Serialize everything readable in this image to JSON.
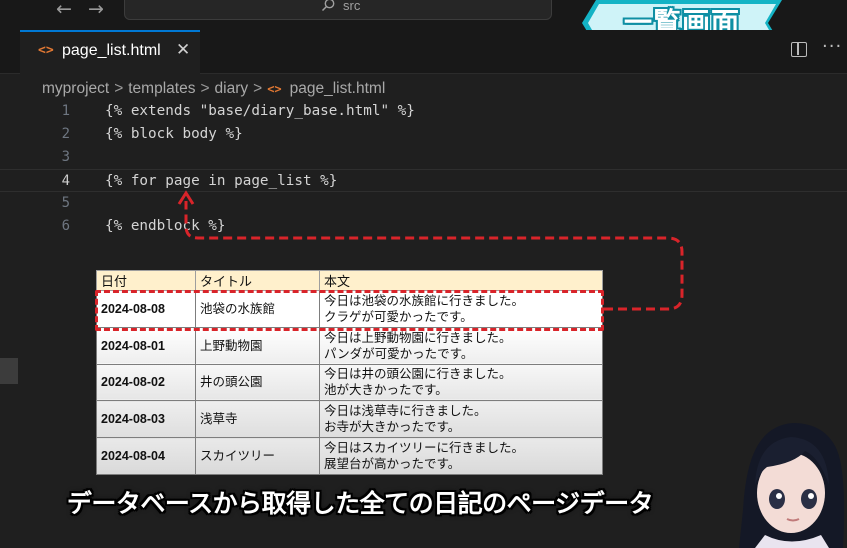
{
  "titlebar": {
    "back_glyph": "←",
    "forward_glyph": "→",
    "search_text": "src"
  },
  "banner": {
    "text": "一覧画面",
    "color": "#14b3c5"
  },
  "tab": {
    "icon_glyph": "<>",
    "label": "page_list.html",
    "close_glyph": "✕",
    "more_glyph": "···"
  },
  "breadcrumb": {
    "parts": [
      "myproject",
      "templates",
      "diary"
    ],
    "file_icon": "<>",
    "file": "page_list.html",
    "separator": ">"
  },
  "editor": {
    "lines": [
      {
        "number": "1",
        "code": "{% extends \"base/diary_base.html\" %}"
      },
      {
        "number": "2",
        "code": "{% block body %}"
      },
      {
        "number": "3",
        "code": ""
      },
      {
        "number": "4",
        "code": "{% for page in page_list %}"
      },
      {
        "number": "5",
        "code": ""
      },
      {
        "number": "6",
        "code": "{% endblock %}"
      }
    ],
    "current_line": "4"
  },
  "table": {
    "headers": [
      "日付",
      "タイトル",
      "本文"
    ],
    "rows": [
      {
        "date": "2024-08-08",
        "title": "池袋の水族館",
        "body1": "今日は池袋の水族館に行きました。",
        "body2": "クラゲが可愛かったです。"
      },
      {
        "date": "2024-08-01",
        "title": "上野動物園",
        "body1": "今日は上野動物園に行きました。",
        "body2": "パンダが可愛かったです。"
      },
      {
        "date": "2024-08-02",
        "title": "井の頭公園",
        "body1": "今日は井の頭公園に行きました。",
        "body2": "池が大きかったです。"
      },
      {
        "date": "2024-08-03",
        "title": "浅草寺",
        "body1": "今日は浅草寺に行きました。",
        "body2": "お寺が大きかったです。"
      },
      {
        "date": "2024-08-04",
        "title": "スカイツリー",
        "body1": "今日はスカイツリーに行きました。",
        "body2": "展望台が高かったです。"
      }
    ],
    "highlight_color": "#d9242a"
  },
  "subtitle": "データベースから取得した全ての日記のページデータ",
  "colors": {
    "editor_bg": "#1f1f1f",
    "accent": "#0078d4",
    "html_icon": "#e37933",
    "table_header": "#fff0cc"
  }
}
